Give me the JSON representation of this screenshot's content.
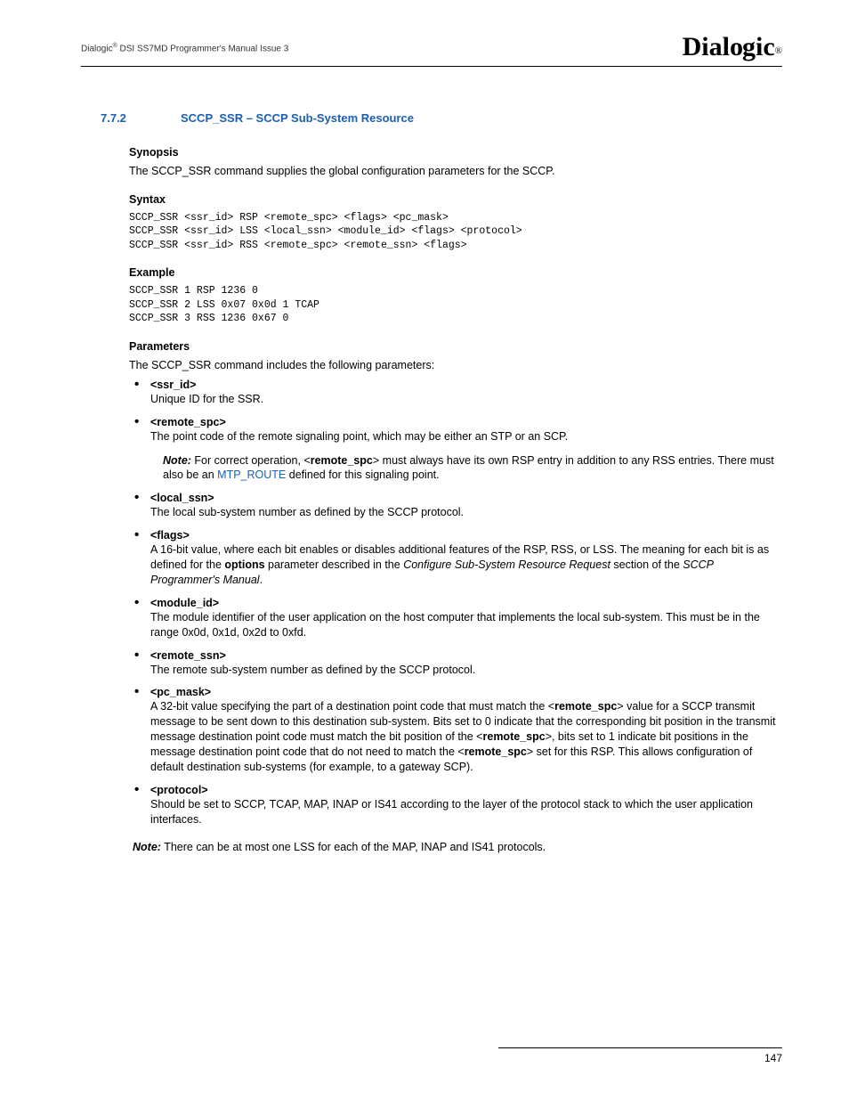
{
  "header": {
    "left_prefix": "Dialogic",
    "left_suffix": " DSI SS7MD Programmer's Manual  Issue 3",
    "logo": "Dialogic"
  },
  "section": {
    "number": "7.7.2",
    "title": "SCCP_SSR – SCCP Sub-System Resource"
  },
  "synopsis": {
    "heading": "Synopsis",
    "text": "The SCCP_SSR command supplies the global configuration parameters for the SCCP."
  },
  "syntax": {
    "heading": "Syntax",
    "code": "SCCP_SSR <ssr_id> RSP <remote_spc> <flags> <pc_mask>\nSCCP_SSR <ssr_id> LSS <local_ssn> <module_id> <flags> <protocol>\nSCCP_SSR <ssr_id> RSS <remote_spc> <remote_ssn> <flags>"
  },
  "example": {
    "heading": "Example",
    "code": "SCCP_SSR 1 RSP 1236 0\nSCCP_SSR 2 LSS 0x07 0x0d 1 TCAP\nSCCP_SSR 3 RSS 1236 0x67 0"
  },
  "parameters": {
    "heading": "Parameters",
    "intro": "The SCCP_SSR command includes the following parameters:",
    "items": [
      {
        "name": "<ssr_id>",
        "desc": "Unique ID for the SSR."
      },
      {
        "name": "<remote_spc>",
        "desc": "The point code of the remote signaling point, which may be either an STP or an SCP."
      },
      {
        "name": "<local_ssn>",
        "desc": "The local sub-system number as defined by the SCCP protocol."
      },
      {
        "name": "<flags>",
        "desc_prefix": "A 16-bit value, where each bit enables or disables additional features of the RSP, RSS, or LSS. The meaning for each bit is as defined for the ",
        "desc_bold1": "options",
        "desc_mid": " parameter described in the ",
        "desc_italic1": "Configure Sub-System Resource Request",
        "desc_mid2": " section of the ",
        "desc_italic2": "SCCP Programmer's Manual",
        "desc_suffix": "."
      },
      {
        "name": "<module_id>",
        "desc": "The module identifier of the user application on the host computer that implements the local sub-system. This must be in the range 0x0d, 0x1d, 0x2d to 0xfd."
      },
      {
        "name": "<remote_ssn>",
        "desc": "The remote sub-system number as defined by the SCCP protocol."
      },
      {
        "name": "<pc_mask>",
        "desc_prefix": "A 32-bit value specifying the part of a destination point code that must match the <",
        "desc_bold1": "remote_spc",
        "desc_mid": "> value for a SCCP transmit message to be sent down to this destination sub-system. Bits set to 0 indicate that the corresponding bit position in the transmit message destination point code must match the bit position of the <",
        "desc_bold2": "remote_spc",
        "desc_mid2": ">, bits set to 1 indicate bit positions in the message destination point code that do not need to match the <",
        "desc_bold3": "remote_spc",
        "desc_suffix": "> set for this RSP. This allows configuration of default destination sub-systems (for example, to a gateway SCP)."
      },
      {
        "name": "<protocol>",
        "desc": "Should be set to SCCP, TCAP, MAP, INAP or IS41 according to the layer of the protocol stack to which the user application interfaces."
      }
    ],
    "note1": {
      "label": "Note:",
      "text_prefix": "  For correct operation, <",
      "bold": "remote_spc",
      "text_mid": "> must always have its own RSP entry in addition to any RSS entries. There must also be an ",
      "link": "MTP_ROUTE",
      "text_suffix": " defined for this signaling point."
    },
    "note2": {
      "label": "Note:",
      "text": "  There can be at most one LSS for each of the MAP, INAP and IS41 protocols."
    }
  },
  "footer": {
    "page": "147"
  }
}
